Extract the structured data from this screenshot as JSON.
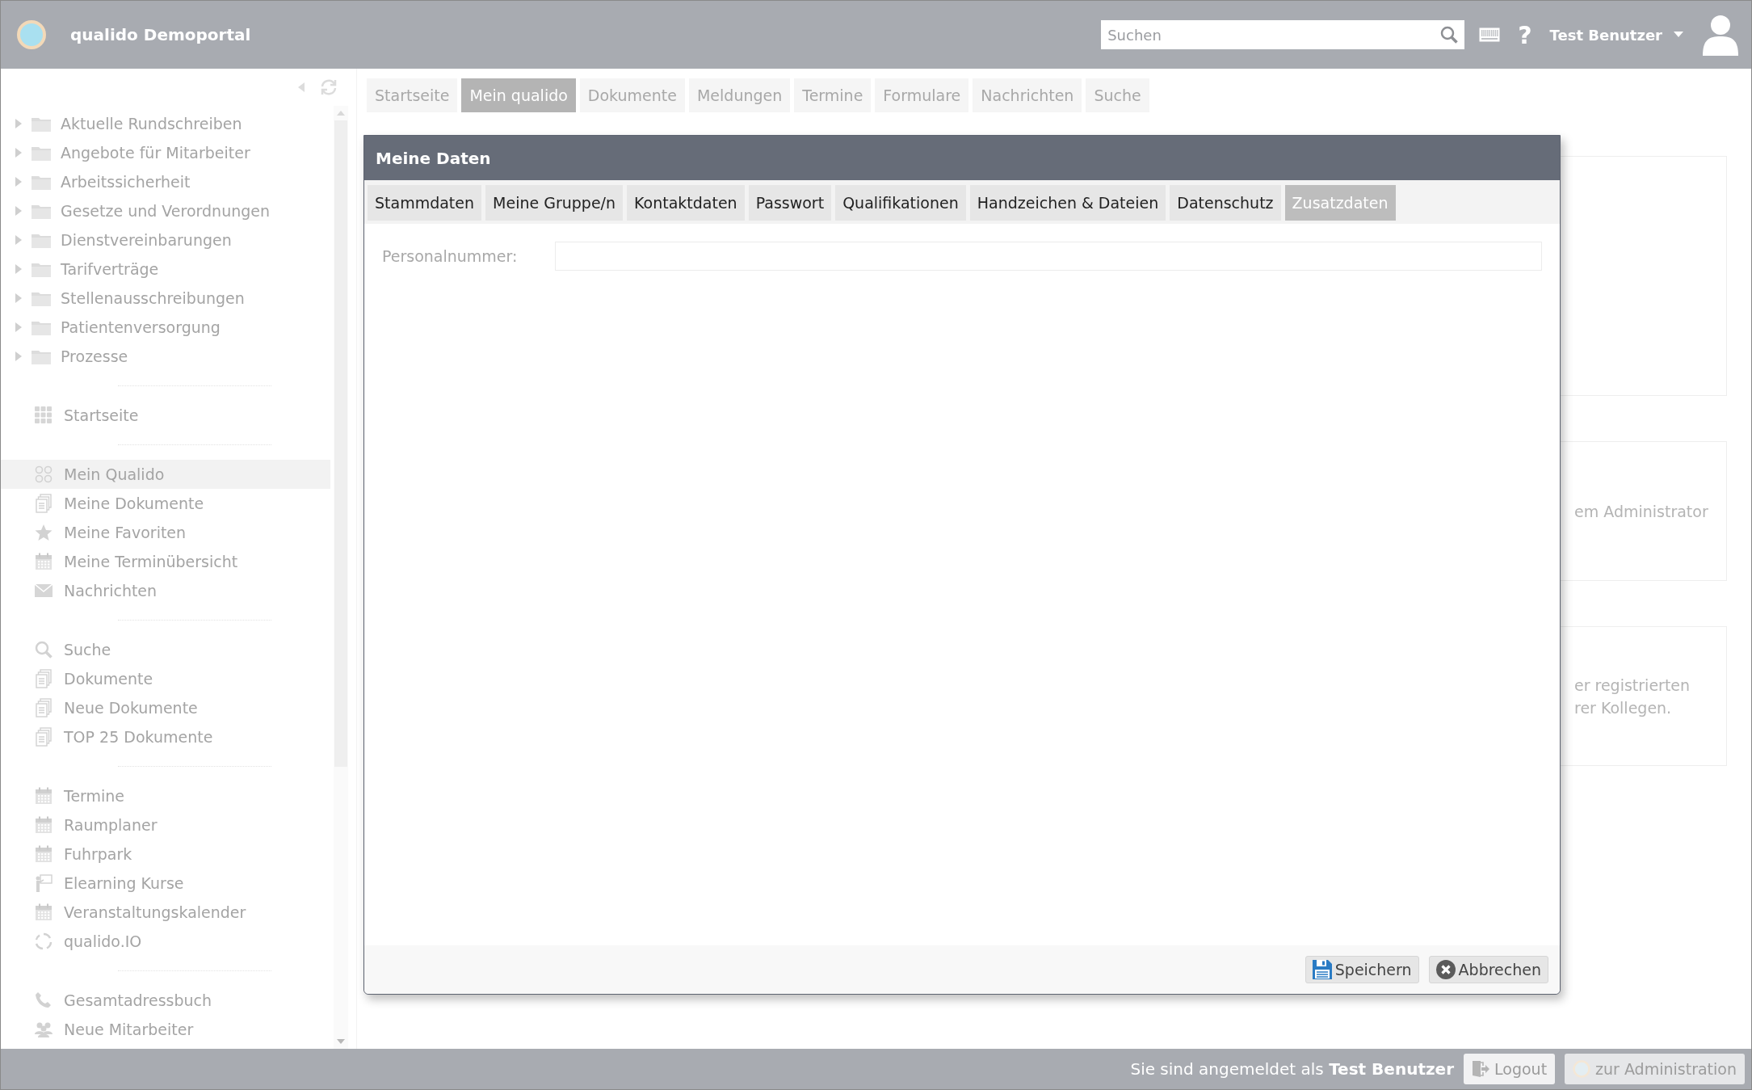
{
  "header": {
    "title": "qualido Demoportal",
    "search": {
      "placeholder": "Suchen"
    },
    "help": "?",
    "user": "Test Benutzer"
  },
  "sidebar": {
    "tree": [
      {
        "label": "Aktuelle Rundschreiben",
        "expanded": false
      },
      {
        "label": "Angebote für Mitarbeiter",
        "expanded": false
      },
      {
        "label": "Arbeitssicherheit",
        "expanded": false
      },
      {
        "label": "Gesetze und Verordnungen",
        "expanded": false
      },
      {
        "label": "Dienstvereinbarungen",
        "expanded": false
      },
      {
        "label": "Tarifverträge",
        "expanded": false
      },
      {
        "label": "Stellenausschreibungen",
        "expanded": false
      },
      {
        "label": "Patientenversorgung",
        "expanded": false
      },
      {
        "label": "Prozesse",
        "expanded": false
      }
    ],
    "groups": [
      [
        {
          "label": "Startseite",
          "kind": "grid",
          "selected": false
        }
      ],
      [
        {
          "label": "Mein Qualido",
          "kind": "rings",
          "selected": true
        },
        {
          "label": "Meine Dokumente",
          "kind": "docs",
          "selected": false
        },
        {
          "label": "Meine Favoriten",
          "kind": "star",
          "selected": false
        },
        {
          "label": "Meine Terminübersicht",
          "kind": "calendar",
          "selected": false
        },
        {
          "label": "Nachrichten",
          "kind": "mail",
          "selected": false
        }
      ],
      [
        {
          "label": "Suche",
          "kind": "search",
          "selected": false
        },
        {
          "label": "Dokumente",
          "kind": "docs",
          "selected": false
        },
        {
          "label": "Neue Dokumente",
          "kind": "docs",
          "selected": false
        },
        {
          "label": "TOP 25 Dokumente",
          "kind": "docs",
          "selected": false
        }
      ],
      [
        {
          "label": "Termine",
          "kind": "calendar",
          "selected": false
        },
        {
          "label": "Raumplaner",
          "kind": "calendar",
          "selected": false
        },
        {
          "label": "Fuhrpark",
          "kind": "calendar",
          "selected": false
        },
        {
          "label": "Elearning Kurse",
          "kind": "teacher",
          "selected": false
        },
        {
          "label": "Veranstaltungskalender",
          "kind": "calendar",
          "selected": false
        },
        {
          "label": "qualido.IO",
          "kind": "cycle",
          "selected": false
        }
      ],
      [
        {
          "label": "Gesamtadressbuch",
          "kind": "phone",
          "selected": false
        },
        {
          "label": "Neue Mitarbeiter",
          "kind": "people",
          "selected": false
        }
      ]
    ]
  },
  "nav_tabs": [
    {
      "label": "Startseite",
      "selected": false
    },
    {
      "label": "Mein qualido",
      "selected": true
    },
    {
      "label": "Dokumente",
      "selected": false
    },
    {
      "label": "Meldungen",
      "selected": false
    },
    {
      "label": "Termine",
      "selected": false
    },
    {
      "label": "Formulare",
      "selected": false
    },
    {
      "label": "Nachrichten",
      "selected": false
    },
    {
      "label": "Suche",
      "selected": false
    }
  ],
  "background_cards": [
    {
      "lines": [
        "em Administrator"
      ]
    },
    {
      "lines": [
        "er registrierten",
        "rer Kollegen."
      ]
    }
  ],
  "dialog": {
    "title": "Meine Daten",
    "tabs": [
      {
        "label": "Stammdaten",
        "selected": false
      },
      {
        "label": "Meine Gruppe/n",
        "selected": false
      },
      {
        "label": "Kontaktdaten",
        "selected": false
      },
      {
        "label": "Passwort",
        "selected": false
      },
      {
        "label": "Qualifikationen",
        "selected": false
      },
      {
        "label": "Handzeichen & Dateien",
        "selected": false
      },
      {
        "label": "Datenschutz",
        "selected": false
      },
      {
        "label": "Zusatzdaten",
        "selected": true
      }
    ],
    "fields": [
      {
        "label": "Personalnummer:"
      }
    ],
    "buttons": [
      {
        "label": "Speichern",
        "kind": "save"
      },
      {
        "label": "Abbrechen",
        "kind": "cancel"
      }
    ]
  },
  "status_bar": {
    "login_text": "Sie sind angemeldet als **Test Benutzer**",
    "buttons": [
      {
        "label": "Logout",
        "kind": "logout"
      },
      {
        "label": "zur Administration",
        "kind": "admin"
      }
    ]
  }
}
